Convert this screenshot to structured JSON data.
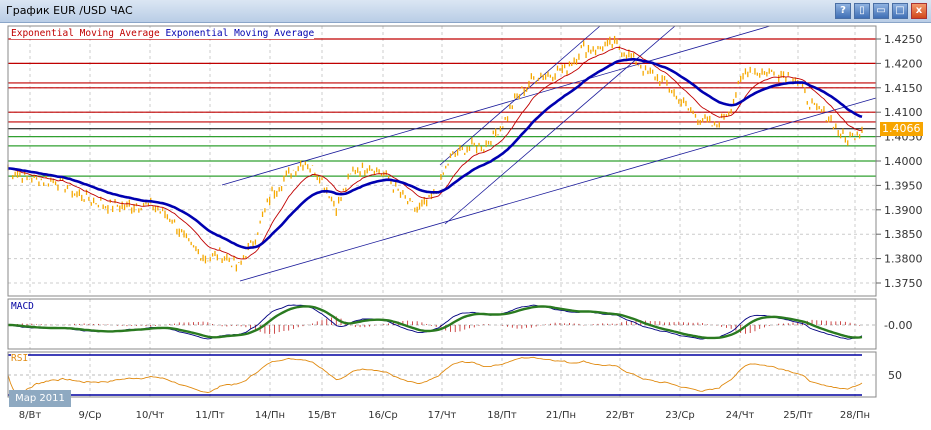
{
  "window": {
    "title": "График EUR /USD  ЧАС",
    "buttons": [
      "?",
      "▯",
      "▭",
      "□",
      "x"
    ]
  },
  "legend": {
    "ema1": "Exponential Moving Average",
    "ema2": "Exponential Moving Average"
  },
  "colors": {
    "price": "#f5a800",
    "ema_fast": "#c00000",
    "ema_slow": "#0000b0",
    "macd_signal": "#2a7a20",
    "rsi": "#e08a10",
    "hline_red": "#c00000",
    "hline_green": "#30a030"
  },
  "chart_data": {
    "type": "line",
    "symbol": "EUR/USD",
    "timeframe": "ЧАС",
    "price_axis": {
      "ticks": [
        "1.4250",
        "1.4200",
        "1.4150",
        "1.4100",
        "1.4050",
        "1.4000",
        "1.3950",
        "1.3900",
        "1.3850",
        "1.3800",
        "1.3750"
      ],
      "range": [
        1.3725,
        1.4275
      ]
    },
    "current_price": "1.4066",
    "close": [
      1.3985,
      1.3965,
      1.3962,
      1.3958,
      1.3935,
      1.392,
      1.391,
      1.3908,
      1.391,
      1.3905,
      1.388,
      1.383,
      1.38,
      1.381,
      1.378,
      1.384,
      1.393,
      1.397,
      1.4,
      1.397,
      1.3905,
      1.398,
      1.399,
      1.397,
      1.3925,
      1.39,
      1.393,
      1.401,
      1.403,
      1.403,
      1.407,
      1.413,
      1.417,
      1.418,
      1.419,
      1.423,
      1.423,
      1.424,
      1.421,
      1.418,
      1.416,
      1.412,
      1.409,
      1.407,
      1.411,
      1.419,
      1.418,
      1.418,
      1.417,
      1.411,
      1.409,
      1.404,
      1.4066
    ],
    "red_levels": [
      1.425,
      1.42,
      1.416,
      1.415,
      1.41,
      1.408
    ],
    "green_levels": [
      1.405,
      1.4031,
      1.4,
      1.3969
    ],
    "x_labels": [
      "8/Вт",
      "9/Ср",
      "10/Чт",
      "11/Пт",
      "14/Пн",
      "15/Вт",
      "16/Ср",
      "17/Чт",
      "18/Пт",
      "21/Пн",
      "22/Вт",
      "23/Ср",
      "24/Чт",
      "25/Пт",
      "28/Пн"
    ],
    "month_label": "Мар 2011",
    "macd": {
      "label": "MACD",
      "tick": "-0.00"
    },
    "rsi": {
      "label": "RSI",
      "tick": "50"
    }
  }
}
